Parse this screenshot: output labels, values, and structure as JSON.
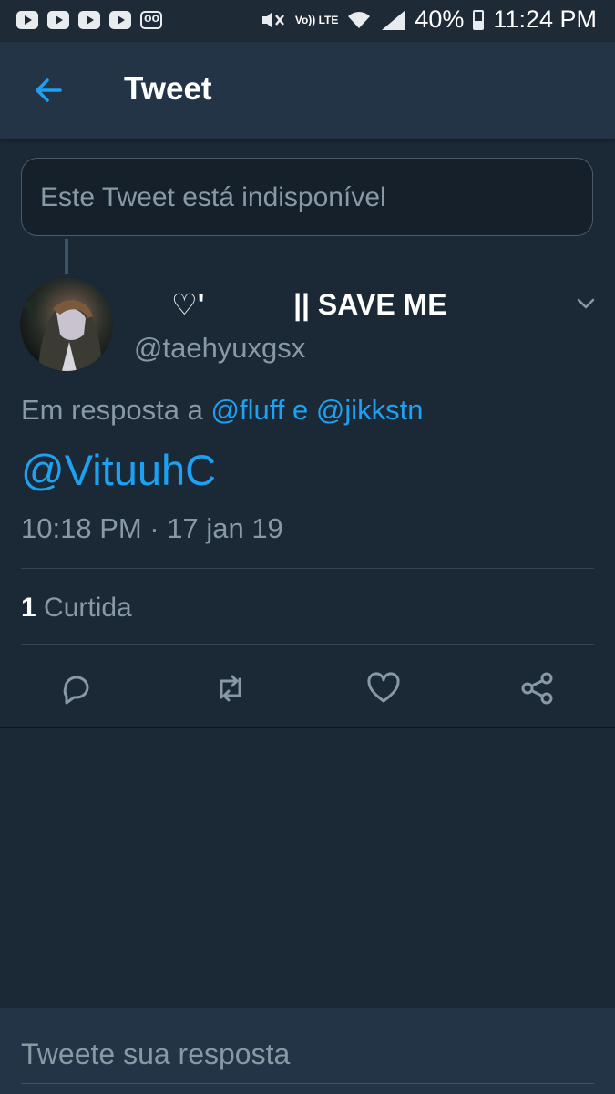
{
  "status_bar": {
    "left_icons": [
      "youtube-icon",
      "youtube-icon",
      "youtube-icon",
      "youtube-icon",
      "voicemail-icon"
    ],
    "volte_label": "Vo)) LTE",
    "battery": "40%",
    "time": "11:24 PM"
  },
  "app_bar": {
    "title": "Tweet"
  },
  "unavailable_tweet": "Este Tweet está indisponível",
  "tweet": {
    "display_name": "♡'           || SAVE ME",
    "handle": "@taehyuxgsx",
    "replying_prefix": "Em resposta a",
    "replying_user1": "@fluff",
    "replying_joiner": "e",
    "replying_user2": "@jikkstn",
    "text": "@VituuhC",
    "timestamp": "10:18 PM · 17 jan 19",
    "like_count": "1",
    "like_label": "Curtida"
  },
  "reply_box": {
    "placeholder": "Tweete sua resposta"
  },
  "colors": {
    "background": "#1b2836",
    "appbar": "#243447",
    "accent": "#1da1f2",
    "muted": "#8899a6"
  }
}
